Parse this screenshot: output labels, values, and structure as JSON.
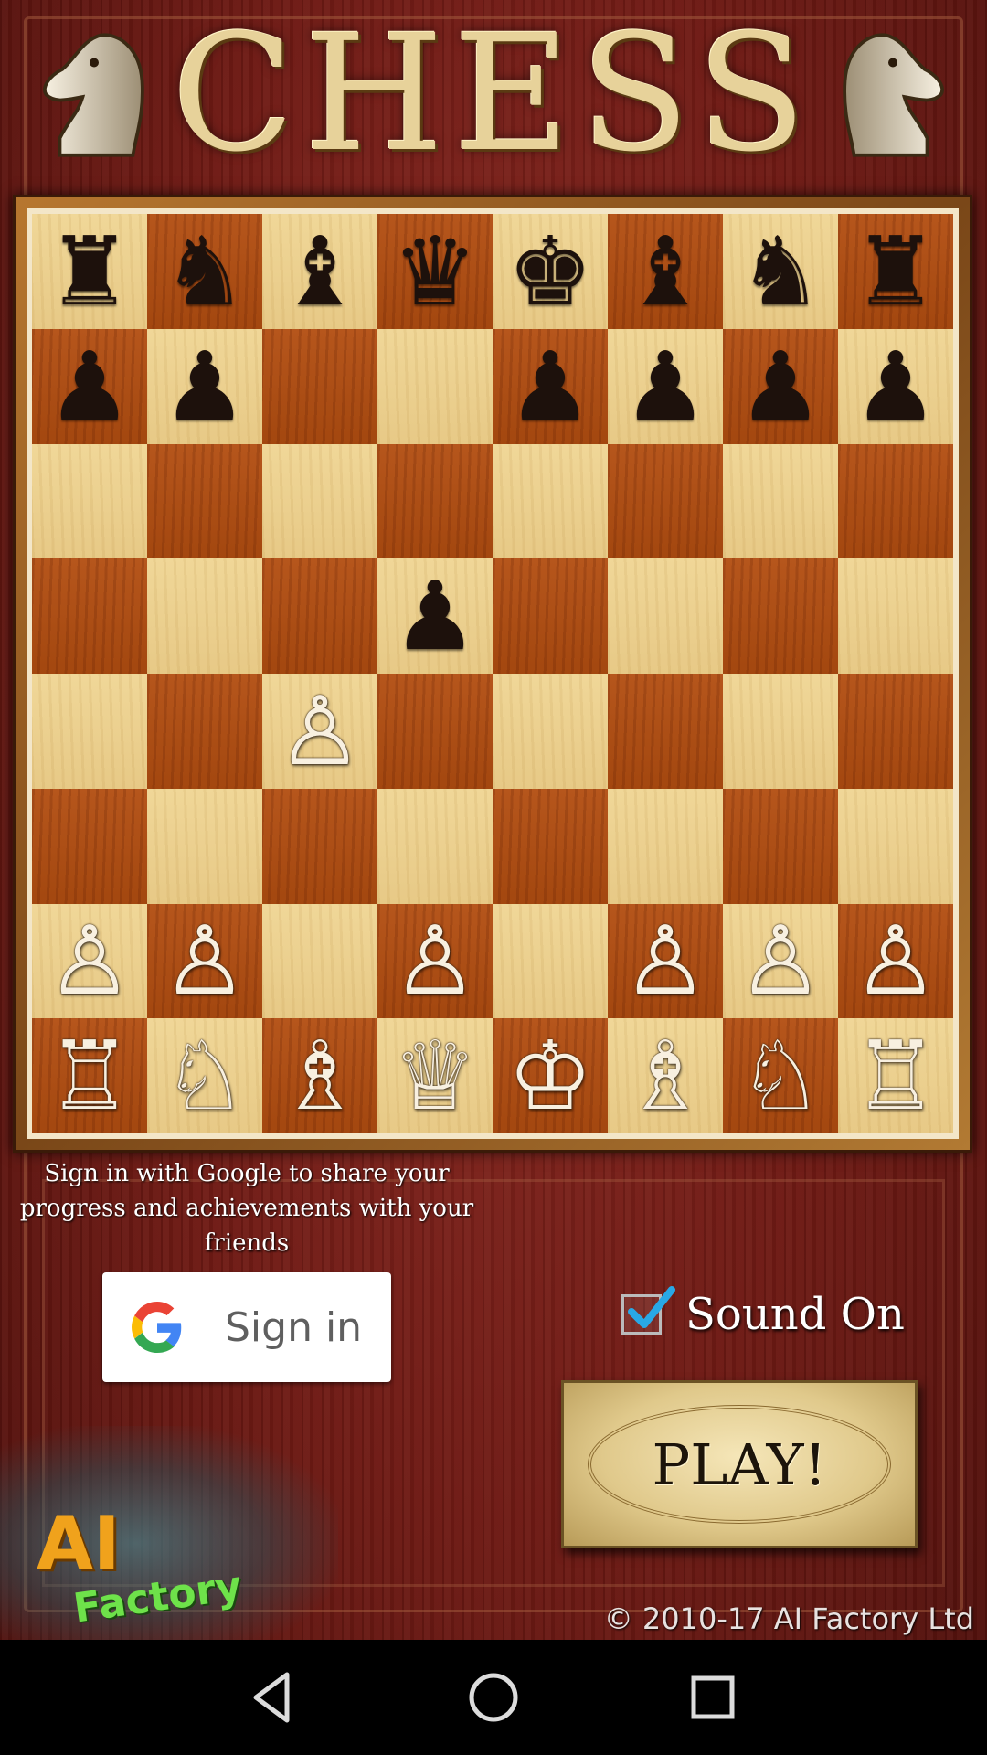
{
  "app": {
    "title": "CHESS"
  },
  "board": {
    "rows": [
      [
        {
          "p": "♜",
          "c": "black"
        },
        {
          "p": "♞",
          "c": "black"
        },
        {
          "p": "♝",
          "c": "black"
        },
        {
          "p": "♛",
          "c": "black"
        },
        {
          "p": "♚",
          "c": "black"
        },
        {
          "p": "♝",
          "c": "black"
        },
        {
          "p": "♞",
          "c": "black"
        },
        {
          "p": "♜",
          "c": "black"
        }
      ],
      [
        {
          "p": "♟",
          "c": "black"
        },
        {
          "p": "♟",
          "c": "black"
        },
        null,
        null,
        {
          "p": "♟",
          "c": "black"
        },
        {
          "p": "♟",
          "c": "black"
        },
        {
          "p": "♟",
          "c": "black"
        },
        {
          "p": "♟",
          "c": "black"
        }
      ],
      [
        null,
        null,
        null,
        null,
        null,
        null,
        null,
        null
      ],
      [
        null,
        null,
        null,
        {
          "p": "♟",
          "c": "black"
        },
        null,
        null,
        null,
        null
      ],
      [
        null,
        null,
        {
          "p": "♙",
          "c": "white"
        },
        null,
        null,
        null,
        null,
        null
      ],
      [
        null,
        null,
        null,
        null,
        null,
        null,
        null,
        null
      ],
      [
        {
          "p": "♙",
          "c": "white"
        },
        {
          "p": "♙",
          "c": "white"
        },
        null,
        {
          "p": "♙",
          "c": "white"
        },
        null,
        {
          "p": "♙",
          "c": "white"
        },
        {
          "p": "♙",
          "c": "white"
        },
        {
          "p": "♙",
          "c": "white"
        }
      ],
      [
        {
          "p": "♖",
          "c": "white"
        },
        {
          "p": "♘",
          "c": "white"
        },
        {
          "p": "♗",
          "c": "white"
        },
        {
          "p": "♕",
          "c": "white"
        },
        {
          "p": "♔",
          "c": "white"
        },
        {
          "p": "♗",
          "c": "white"
        },
        {
          "p": "♘",
          "c": "white"
        },
        {
          "p": "♖",
          "c": "white"
        }
      ]
    ],
    "light_square_color": "#ecd08f",
    "dark_square_color": "#ab4e15"
  },
  "signin": {
    "prompt": "Sign in with Google to share your progress and achievements with your friends",
    "button_label": "Sign in",
    "icon": "google-icon"
  },
  "sound": {
    "label": "Sound On",
    "checked": true
  },
  "play": {
    "label": "PLAY!"
  },
  "branding": {
    "logo_ai": "AI",
    "logo_factory": "Factory",
    "copyright": "© 2010-17 AI Factory Ltd"
  },
  "nav": {
    "icons": [
      "back-icon",
      "home-icon",
      "recents-icon"
    ]
  }
}
